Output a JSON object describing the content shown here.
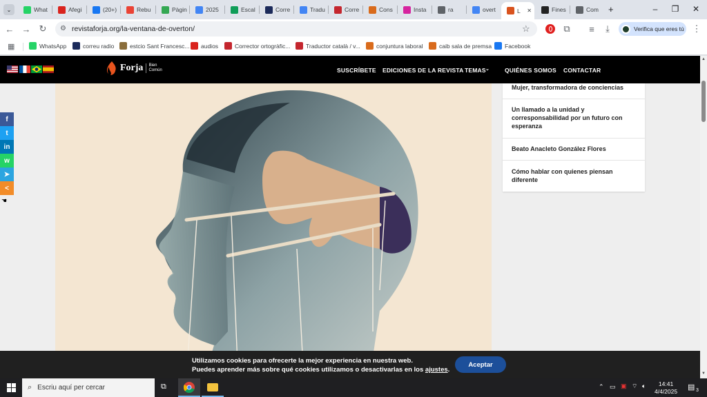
{
  "tabs": [
    {
      "label": "What",
      "icon": "whatsapp-icon",
      "color": "#25d366"
    },
    {
      "label": "Afegi",
      "icon": "flag-icon",
      "color": "#d9231d"
    },
    {
      "label": "(20+)",
      "icon": "facebook-icon",
      "color": "#1877f2"
    },
    {
      "label": "Rebu",
      "icon": "gmail-icon",
      "color": "#ea4335"
    },
    {
      "label": "Pàgin",
      "icon": "drive-icon",
      "color": "#34a853"
    },
    {
      "label": "2025",
      "icon": "docs-icon",
      "color": "#4285f4"
    },
    {
      "label": "Escal",
      "icon": "sheets-icon",
      "color": "#0f9d58"
    },
    {
      "label": "Corre",
      "icon": "v-icon",
      "color": "#1b2a5a"
    },
    {
      "label": "Tradu",
      "icon": "translate-icon",
      "color": "#4285f4"
    },
    {
      "label": "Corre",
      "icon": "sc-icon",
      "color": "#c4262e"
    },
    {
      "label": "Cons",
      "icon": "gencat-icon",
      "color": "#d96b1c"
    },
    {
      "label": "Insta",
      "icon": "instagram-icon",
      "color": "#d6249f"
    },
    {
      "label": "ra",
      "icon": "globe-icon",
      "color": "#5f6368"
    },
    {
      "label": "overt",
      "icon": "google-icon",
      "color": "#4285f4"
    },
    {
      "label": "L",
      "icon": "forja-icon",
      "color": "#d9531e"
    },
    {
      "label": "Fines",
      "icon": "wikipedia-icon",
      "color": "#222222"
    },
    {
      "label": "Com",
      "icon": "globe-icon",
      "color": "#5f6368"
    }
  ],
  "active_tab_index": 14,
  "address": {
    "url": "revistaforja.org/la-ventana-de-overton/"
  },
  "profile": {
    "verify_label": "Verifica que eres tú"
  },
  "bookmarks": [
    {
      "label": "WhatsApp",
      "color": "#25d366"
    },
    {
      "label": "correu radio",
      "color": "#1b2a5a"
    },
    {
      "label": "estcio Sant Francesc...",
      "color": "#8a6d3b"
    },
    {
      "label": "audios",
      "color": "#d9231d"
    },
    {
      "label": "Corrector ortogràfic...",
      "color": "#c4262e"
    },
    {
      "label": "Traductor català / v...",
      "color": "#c4262e"
    },
    {
      "label": "conjuntura laboral",
      "color": "#d96b1c"
    },
    {
      "label": "caib sala de premsa",
      "color": "#d96b1c"
    },
    {
      "label": "Facebook",
      "color": "#1877f2"
    }
  ],
  "site": {
    "logo_text": "Forja",
    "logo_tagline": "Bien Común",
    "nav": [
      "SUSCRÍBETE",
      "EDICIONES DE LA REVISTA",
      "TEMAS",
      "QUIÉNES SOMOS",
      "CONTACTAR"
    ]
  },
  "sidebar": [
    "Mujer, transformadora de conciencias",
    "Un llamado a la unidad y corresponsabilidad por un futuro con esperanza",
    "Beato Anacleto González Flores",
    "Cómo hablar con quienes piensan diferente"
  ],
  "share": [
    {
      "icon": "facebook-icon",
      "color": "#3b5998",
      "glyph": "f"
    },
    {
      "icon": "twitter-icon",
      "color": "#1da1f2",
      "glyph": "t"
    },
    {
      "icon": "linkedin-icon",
      "color": "#0077b5",
      "glyph": "in"
    },
    {
      "icon": "whatsapp-icon",
      "color": "#25d366",
      "glyph": "w"
    },
    {
      "icon": "telegram-icon",
      "color": "#2ca5e0",
      "glyph": "➤"
    },
    {
      "icon": "share-icon",
      "color": "#f28c28",
      "glyph": "<"
    }
  ],
  "cookie": {
    "line1": "Utilizamos cookies para ofrecerte la mejor experiencia en nuestra web.",
    "line2_pre": "Puedes aprender más sobre qué cookies utilizamos o desactivarlas en los ",
    "line2_link": "ajustes",
    "line2_post": ".",
    "accept": "Aceptar"
  },
  "taskbar": {
    "search_placeholder": "Escriu aquí per cercar",
    "time": "14:41",
    "date": "4/4/2025",
    "notification_count": "3"
  }
}
